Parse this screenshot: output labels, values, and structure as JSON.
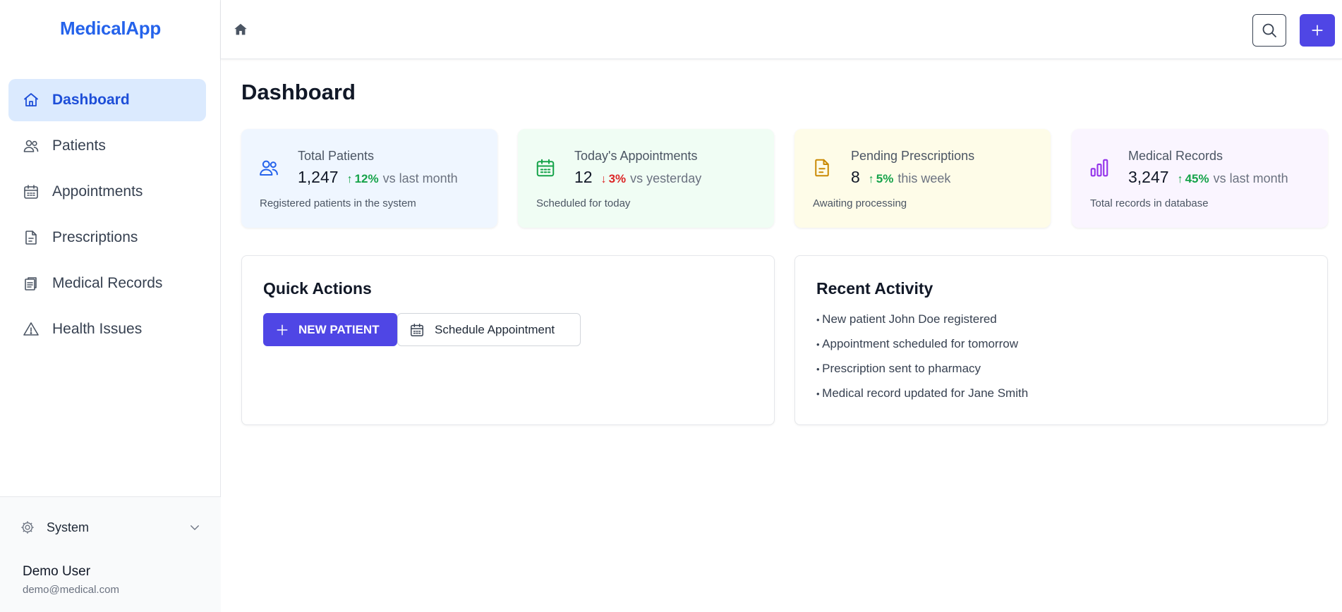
{
  "app": {
    "name": "MedicalApp"
  },
  "sidebar": {
    "items": [
      {
        "label": "Dashboard",
        "icon": "home-icon",
        "active": true
      },
      {
        "label": "Patients",
        "icon": "users-icon",
        "active": false
      },
      {
        "label": "Appointments",
        "icon": "calendar-icon",
        "active": false
      },
      {
        "label": "Prescriptions",
        "icon": "file-text-icon",
        "active": false
      },
      {
        "label": "Medical Records",
        "icon": "clipboard-icon",
        "active": false
      },
      {
        "label": "Health Issues",
        "icon": "alert-triangle-icon",
        "active": false
      }
    ],
    "system_label": "System",
    "user": {
      "name": "Demo User",
      "email": "demo@medical.com"
    }
  },
  "header": {
    "icons": [
      "home-icon",
      "search-icon",
      "plus-icon"
    ]
  },
  "main": {
    "title": "Dashboard",
    "stats": [
      {
        "title": "Total Patients",
        "value": "1,247",
        "trend": "up",
        "arrow": "↑",
        "change": "12%",
        "comparison": "vs last month",
        "description": "Registered patients in the system",
        "icon": "users-icon",
        "accent": "#2563eb",
        "bg": "#eff6ff"
      },
      {
        "title": "Today's Appointments",
        "value": "12",
        "trend": "down",
        "arrow": "↓",
        "change": "3%",
        "comparison": "vs yesterday",
        "description": "Scheduled for today",
        "icon": "calendar-icon",
        "accent": "#16a34a",
        "bg": "#f0fdf4"
      },
      {
        "title": "Pending Prescriptions",
        "value": "8",
        "trend": "up",
        "arrow": "↑",
        "change": "5%",
        "comparison": "this week",
        "description": "Awaiting processing",
        "icon": "file-text-icon",
        "accent": "#ca8a04",
        "bg": "#fefce8"
      },
      {
        "title": "Medical Records",
        "value": "3,247",
        "trend": "up",
        "arrow": "↑",
        "change": "45%",
        "comparison": "vs last month",
        "description": "Total records in database",
        "icon": "bar-chart-icon",
        "accent": "#9333ea",
        "bg": "#faf5ff"
      }
    ],
    "quick_actions": {
      "title": "Quick Actions",
      "new_patient_label": "NEW PATIENT",
      "schedule_label": "Schedule Appointment"
    },
    "recent_activity": {
      "title": "Recent Activity",
      "items": [
        "New patient John Doe registered",
        "Appointment scheduled for tomorrow",
        "Prescription sent to pharmacy",
        "Medical record updated for Jane Smith"
      ]
    }
  },
  "colors": {
    "brand": "#2563eb",
    "primary_button": "#4f46e5",
    "active_nav_bg": "#dbeafe",
    "trend_up": "#16a34a",
    "trend_down": "#dc2626"
  }
}
